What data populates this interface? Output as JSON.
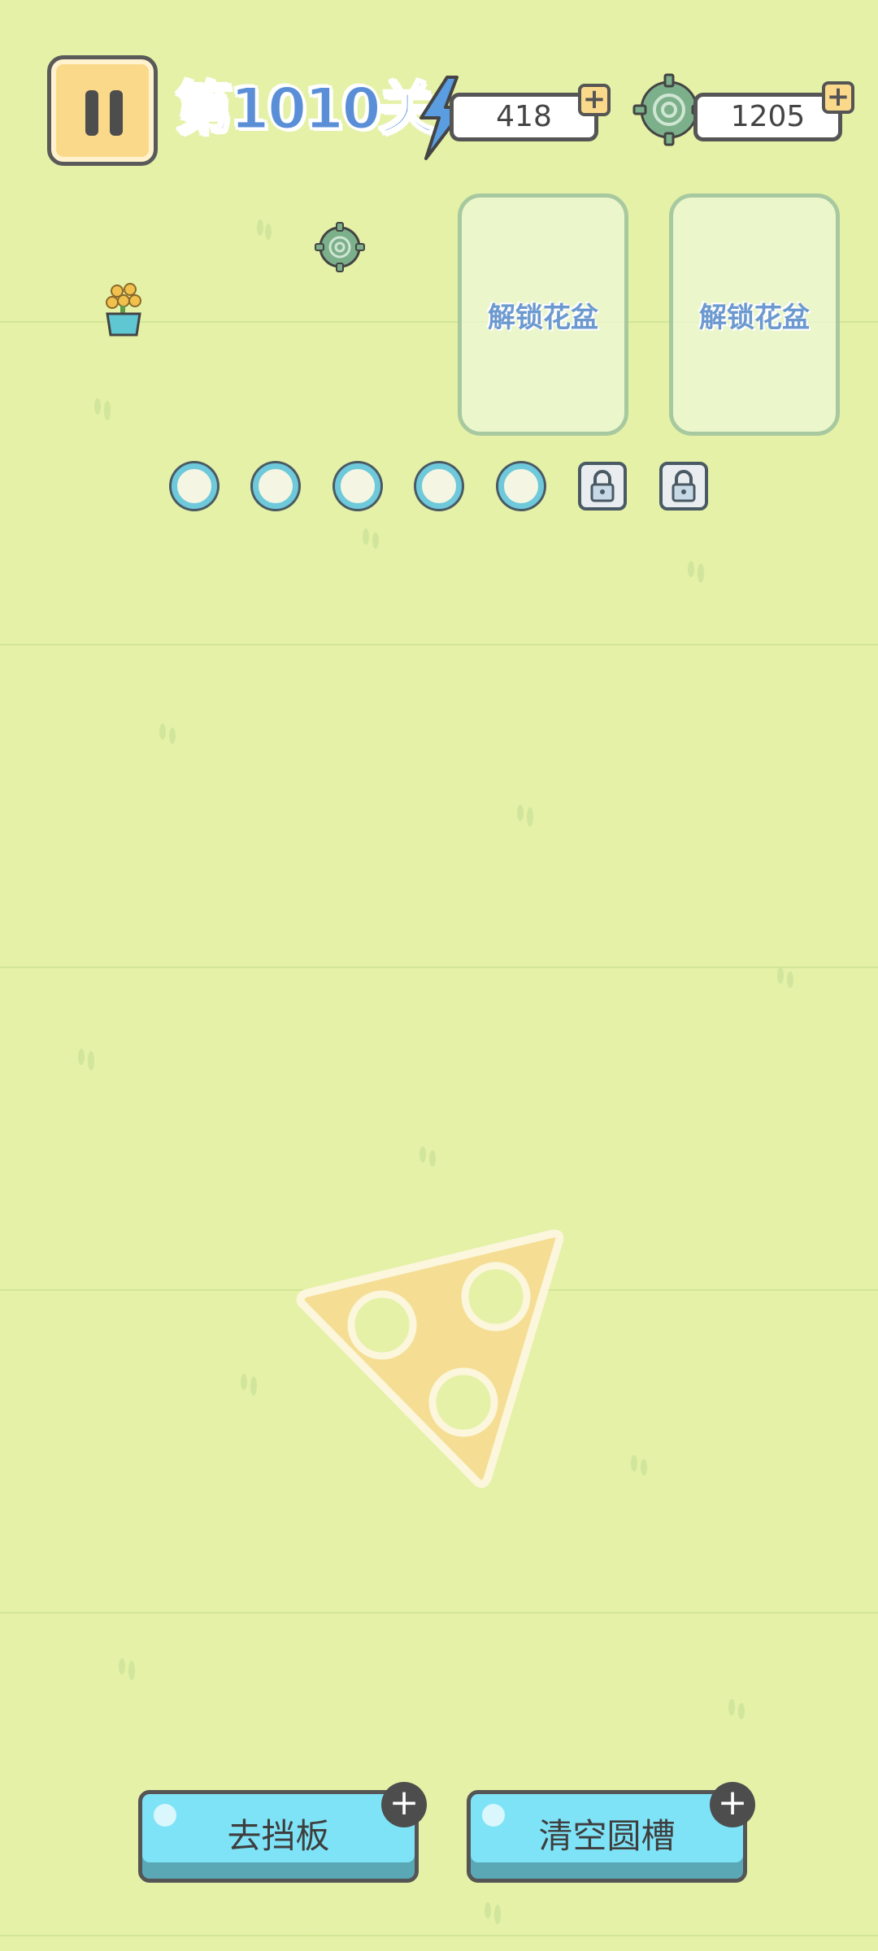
{
  "header": {
    "level_title": "第1010关",
    "energy_value": "418",
    "coins_value": "1205"
  },
  "pot_slots": [
    {
      "label": "解锁花盆"
    },
    {
      "label": "解锁花盆"
    }
  ],
  "slots": {
    "open_count": 5,
    "locked_count": 2
  },
  "buttons": {
    "remove_baffle_label": "去挡板",
    "clear_slots_label": "清空圆槽"
  },
  "icons": [
    "pause-icon",
    "lightning-icon",
    "gear-coin-icon",
    "plant-pot-icon",
    "lock-icon",
    "plus-icon"
  ],
  "colors": {
    "background": "#e4f1a6",
    "title": "#5a8fd8",
    "pause_button": "#fbd98b",
    "hole_ring": "#6ec9db",
    "action_button": "#7fe3f7",
    "triangle_piece": "#f5de94"
  }
}
